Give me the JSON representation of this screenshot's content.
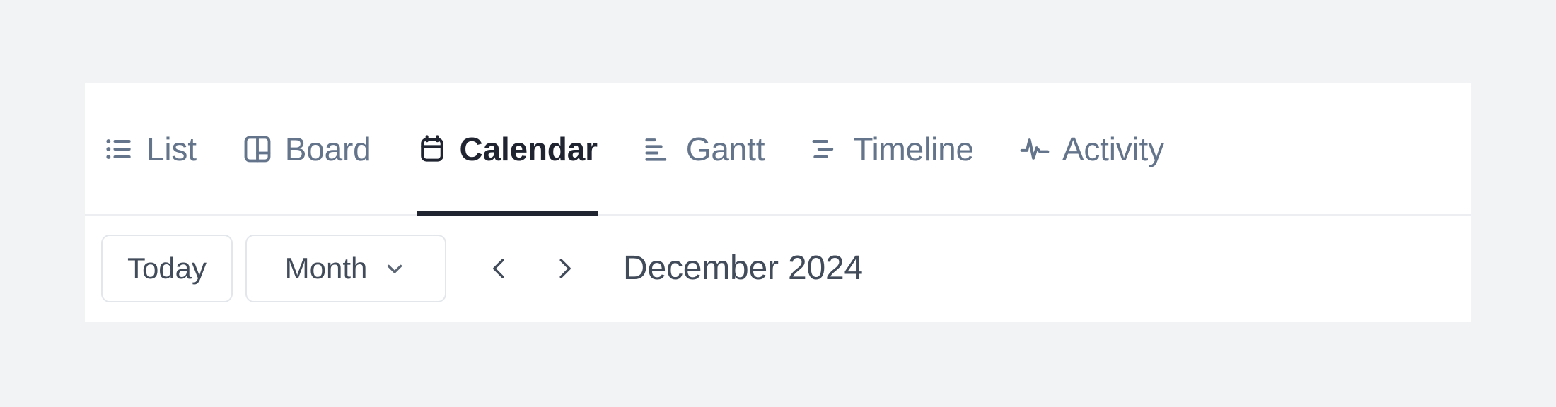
{
  "theme": {
    "page_background": "#f2f3f5",
    "card_background": "#ffffff",
    "muted_text": "#64748b",
    "active_text": "#1f2430",
    "accent_underline": "#1f2430",
    "border": "#e3e6ea",
    "divider": "#eceef1"
  },
  "view_switcher": {
    "tabs": [
      {
        "id": "list",
        "label": "List",
        "icon": "list-icon",
        "active": false
      },
      {
        "id": "board",
        "label": "Board",
        "icon": "board-icon",
        "active": false
      },
      {
        "id": "calendar",
        "label": "Calendar",
        "icon": "calendar-icon",
        "active": true
      },
      {
        "id": "gantt",
        "label": "Gantt",
        "icon": "gantt-icon",
        "active": false
      },
      {
        "id": "timeline",
        "label": "Timeline",
        "icon": "timeline-icon",
        "active": false
      },
      {
        "id": "activity",
        "label": "Activity",
        "icon": "activity-icon",
        "active": false
      }
    ],
    "active_tab": "calendar"
  },
  "toolbar": {
    "today_label": "Today",
    "range_label": "Month",
    "range_options": [
      "Month"
    ],
    "range_caret_icon": "chevron-down-icon",
    "prev_icon": "chevron-left-icon",
    "next_icon": "chevron-right-icon",
    "period_title": "December 2024"
  }
}
